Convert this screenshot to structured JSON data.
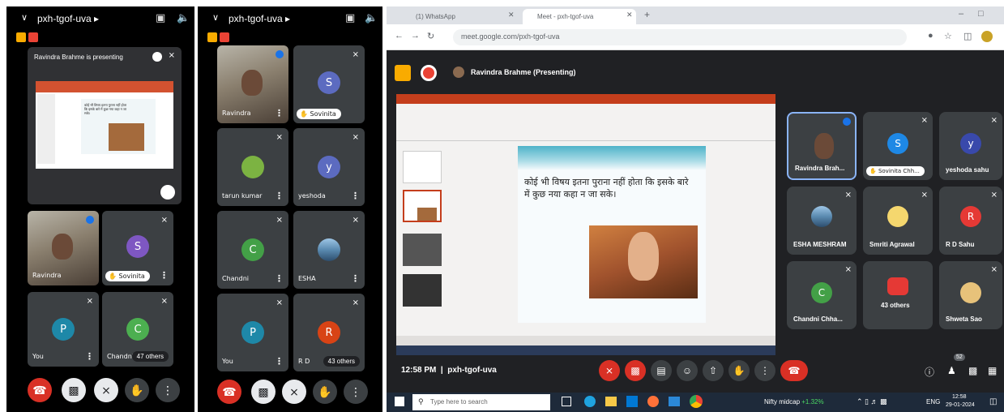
{
  "phone1": {
    "meeting_code": "pxh-tgof-uva",
    "presenting_text": "Ravindra Brahme is presenting",
    "slide_hindi": "कोई भी विषय इतना पुराना नहीं होता कि इसके बारे में कुछ नया कहा न जा सके।",
    "tiles": [
      {
        "name": "Ravindra"
      },
      {
        "name": "Sovinita",
        "initial": "S",
        "color": "#7e57c2"
      },
      {
        "name": "You",
        "initial": "P",
        "color": "#1e88a8"
      },
      {
        "name": "Chandni",
        "initial": "C",
        "color": "#4caf50",
        "others": "47 others"
      }
    ]
  },
  "phone2": {
    "meeting_code": "pxh-tgof-uva",
    "tiles": [
      {
        "name": "Ravindra"
      },
      {
        "name": "Sovinita",
        "initial": "S",
        "color": "#5c6bc0"
      },
      {
        "name": "tarun kumar",
        "color": "#7cb342"
      },
      {
        "name": "yeshoda",
        "initial": "y",
        "color": "#5c6bc0"
      },
      {
        "name": "Chandni",
        "initial": "C",
        "color": "#43a047"
      },
      {
        "name": "ESHA"
      },
      {
        "name": "You",
        "initial": "P",
        "color": "#1e88a8"
      },
      {
        "name": "R D",
        "initial": "R",
        "color": "#d84315",
        "others": "43 others"
      }
    ]
  },
  "desktop": {
    "tabs": [
      "(1) WhatsApp",
      "Meet - pxh-tgof-uva"
    ],
    "url": "meet.google.com/pxh-tgof-uva",
    "presenter_bar": "Ravindra Brahme (Presenting)",
    "slide_hindi": "कोई भी विषय इतना पुराना नहीं होता कि इसके बारे में कुछ नया कहा न जा सके।",
    "tiles": [
      {
        "name": "Ravindra Brah..."
      },
      {
        "name": "Sovinita Chh...",
        "initial": "S",
        "color": "#1e88e5"
      },
      {
        "name": "yeshoda sahu",
        "initial": "y",
        "color": "#3949ab"
      },
      {
        "name": "ESHA MESHRAM"
      },
      {
        "name": "Smriti Agrawal"
      },
      {
        "name": "R D Sahu",
        "initial": "R",
        "color": "#e53935"
      },
      {
        "name": "Chandni Chha...",
        "initial": "C",
        "color": "#43a047"
      },
      {
        "name": "43 others"
      },
      {
        "name": "Shweta Sao"
      }
    ],
    "time_code": "12:58 PM  |  pxh-tgof-uva",
    "people_count": "52",
    "taskbar": {
      "search": "Type here to search",
      "stock": "Nifty midcap",
      "stock_change": "+1.32%",
      "lang": "ENG",
      "time": "12:58",
      "date": "29-01-2024"
    }
  }
}
